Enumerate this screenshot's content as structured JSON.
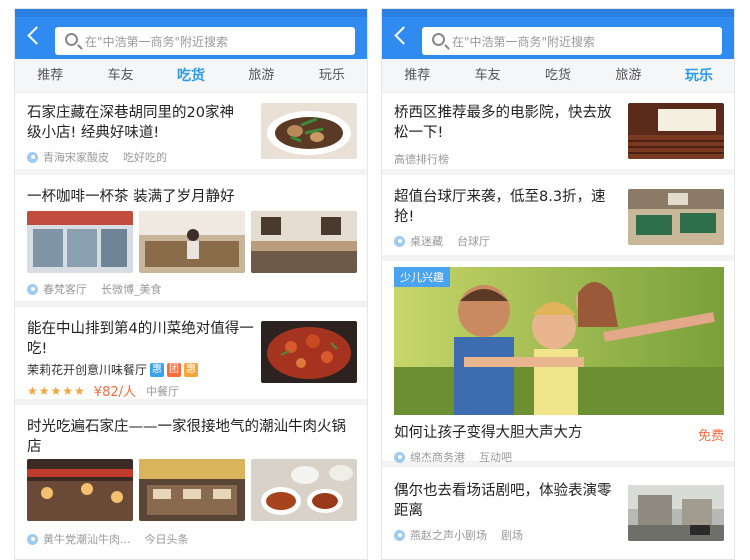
{
  "search": {
    "placeholder": "在\"中浩第一商务\"附近搜索"
  },
  "left": {
    "tabs": [
      "推荐",
      "车友",
      "吃货",
      "旅游",
      "玩乐"
    ],
    "active_tab": 2,
    "items": [
      {
        "title": "石家庄藏在深巷胡同里的20家神级小店! 经典好味道!",
        "location": "青海宋家酸皮",
        "source": "吃好吃的"
      },
      {
        "title": "一杯咖啡一杯茶 装满了岁月静好",
        "location": "春梵客厅",
        "source": "长微博_美食"
      },
      {
        "title": "能在中山排到第4的川菜绝对值得一吃!",
        "shop": "茉莉花开创意川味餐厅",
        "tags": [
          "惠",
          "团",
          "惠"
        ],
        "stars": "★★★★★",
        "price": "¥82/人",
        "area": "中餐厅"
      },
      {
        "title": "时光吃遍石家庄——一家很接地气的潮汕牛肉火锅店",
        "location": "黄牛党潮汕牛肉...",
        "source": "今日头条"
      }
    ]
  },
  "right": {
    "tabs": [
      "推荐",
      "车友",
      "吃货",
      "旅游",
      "玩乐"
    ],
    "active_tab": 4,
    "items": [
      {
        "title": "桥西区推荐最多的电影院，快去放松一下!",
        "source": "高德排行榜"
      },
      {
        "title": "超值台球厅来袭，低至8.3折，速抢!",
        "location": "桌迷藏",
        "source": "台球厅"
      },
      {
        "badge": "少儿兴趣",
        "title": "如何让孩子变得大胆大声大方",
        "location": "绵杰商务港",
        "source": "互动吧",
        "price_label": "免费"
      },
      {
        "title": "偶尔也去看场话剧吧，体验表演零距离",
        "location": "燕赵之声小剧场",
        "source": "剧场"
      }
    ]
  },
  "colors": {
    "primary": "#2f8bf0",
    "active_tab": "#2a9bf2",
    "price": "#ff6a3d",
    "star": "#f7a43a"
  }
}
